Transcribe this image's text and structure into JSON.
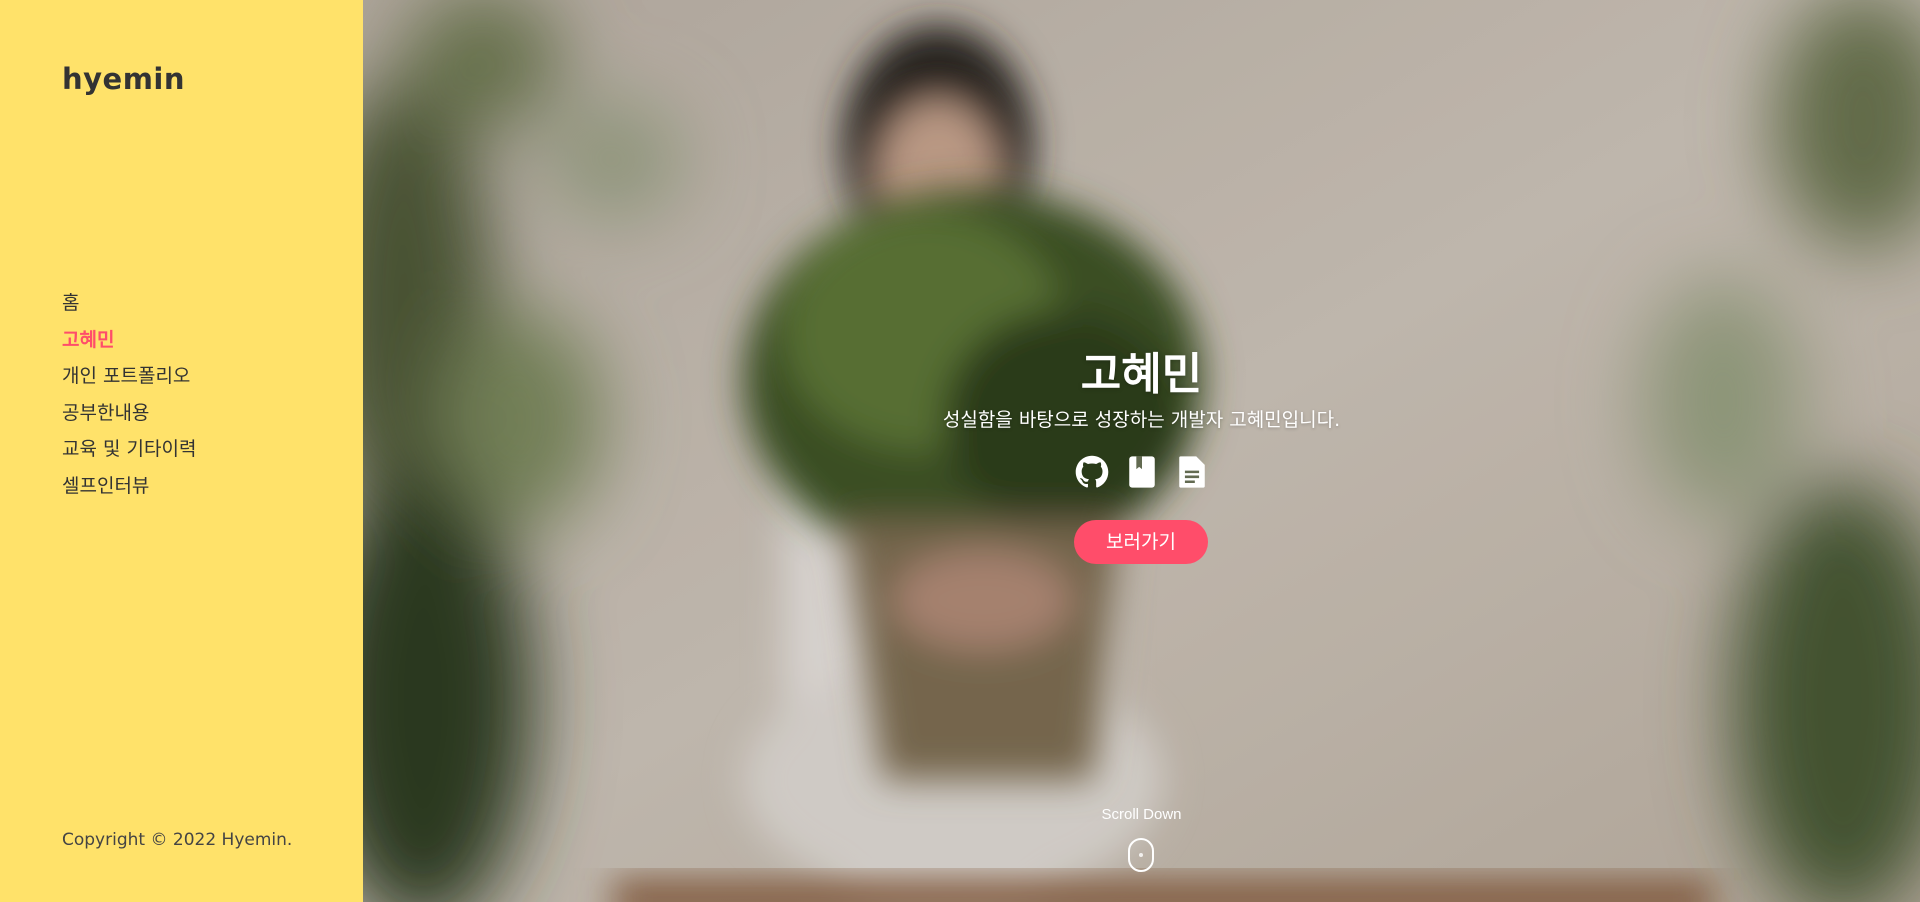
{
  "sidebar": {
    "logo": "hyemin",
    "nav": [
      {
        "label": "홈",
        "active": false
      },
      {
        "label": "고혜민",
        "active": true
      },
      {
        "label": "개인 포트폴리오",
        "active": false
      },
      {
        "label": "공부한내용",
        "active": false
      },
      {
        "label": "교육 및 기타이력",
        "active": false
      },
      {
        "label": "셀프인터뷰",
        "active": false
      }
    ],
    "copyright": "Copyright © 2022 Hyemin."
  },
  "hero": {
    "title": "고혜민",
    "subtitle": "성실함을 바탕으로 성장하는 개발자 고혜민입니다.",
    "icons": [
      "github-icon",
      "book-icon",
      "document-icon"
    ],
    "cta_label": "보러가기",
    "scroll_label": "Scroll Down"
  },
  "colors": {
    "sidebar_bg": "#ffe26a",
    "accent": "#ff4d6a",
    "text": "#333333"
  }
}
